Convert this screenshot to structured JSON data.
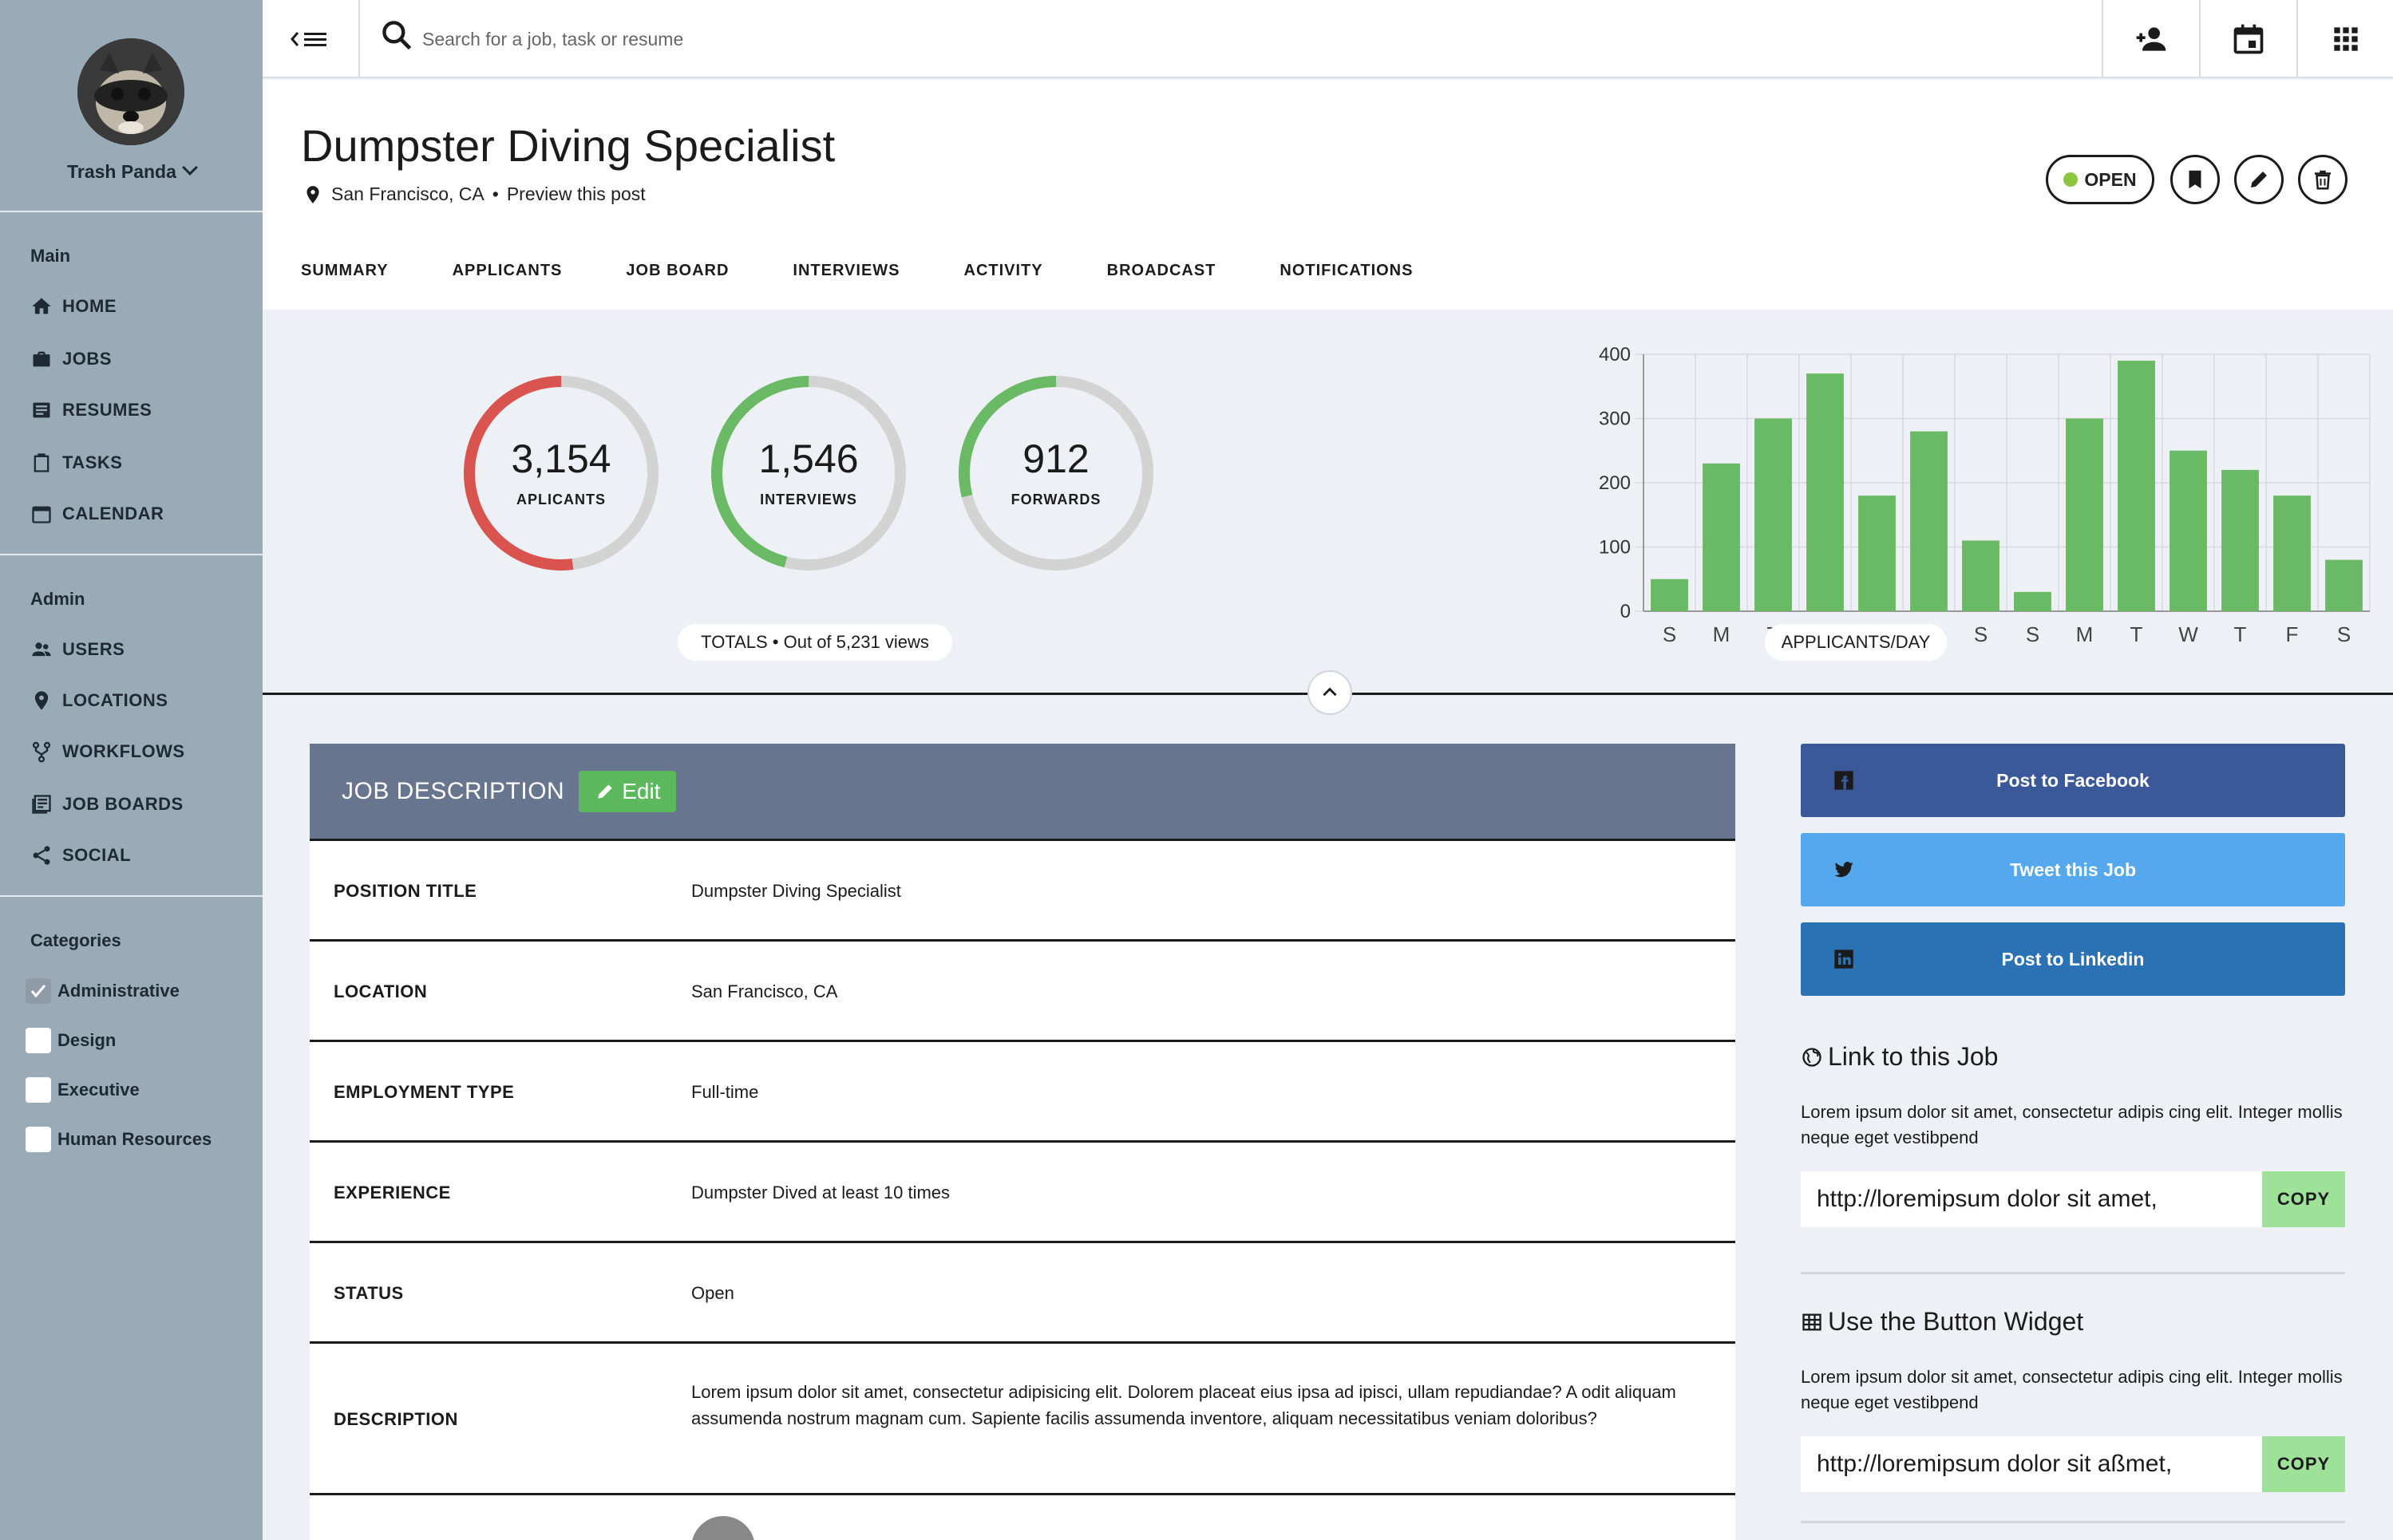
{
  "sidebar": {
    "username": "Trash Panda",
    "main_heading": "Main",
    "main_items": [
      {
        "label": "HOME",
        "icon": "home-icon"
      },
      {
        "label": "JOBS",
        "icon": "briefcase-icon"
      },
      {
        "label": "RESUMES",
        "icon": "resume-icon"
      },
      {
        "label": "TASKS",
        "icon": "clipboard-icon"
      },
      {
        "label": "CALENDAR",
        "icon": "calendar-icon"
      }
    ],
    "admin_heading": "Admin",
    "admin_items": [
      {
        "label": "USERS",
        "icon": "users-icon"
      },
      {
        "label": "LOCATIONS",
        "icon": "location-pin-icon"
      },
      {
        "label": "WORKFLOWS",
        "icon": "workflow-icon"
      },
      {
        "label": "JOB BOARDS",
        "icon": "job-boards-icon"
      },
      {
        "label": "SOCIAL",
        "icon": "share-icon"
      }
    ],
    "categories_heading": "Categories",
    "categories": [
      {
        "label": "Administrative",
        "checked": true
      },
      {
        "label": "Design",
        "checked": false
      },
      {
        "label": "Executive",
        "checked": false
      },
      {
        "label": "Human Resources",
        "checked": false
      }
    ]
  },
  "topbar": {
    "search_placeholder": "Search for a job, task or resume",
    "buttons": [
      "add-user-icon",
      "calendar-icon",
      "apps-grid-icon"
    ]
  },
  "job": {
    "title": "Dumpster Diving Specialist",
    "location": "San Francisco, CA",
    "separator": "•",
    "preview_link": "Preview this post",
    "status": "OPEN",
    "status_color": "#8cc63f",
    "tabs": [
      "SUMMARY",
      "APPLICANTS",
      "JOB BOARD",
      "INTERVIEWS",
      "ACTIVITY",
      "BROADCAST",
      "NOTIFICATIONS"
    ]
  },
  "stats": {
    "rings": [
      {
        "value": "3,154",
        "label": "APLICANTS",
        "fraction": 0.52,
        "color": "#d9534f"
      },
      {
        "value": "1,546",
        "label": "INTERVIEWS",
        "fraction": 0.46,
        "color": "#6ab964"
      },
      {
        "value": "912",
        "label": "FORWARDS",
        "fraction": 0.29,
        "color": "#6ab964"
      }
    ],
    "totals_label": "TOTALS • Out of 5,231 views",
    "chart_label": "APPLICANTS/DAY"
  },
  "chart_data": {
    "type": "bar",
    "categories": [
      "S",
      "M",
      "T",
      "W",
      "T",
      "F",
      "S",
      "S",
      "M",
      "T",
      "W",
      "T",
      "F",
      "S"
    ],
    "values": [
      50,
      230,
      300,
      370,
      180,
      280,
      110,
      30,
      300,
      390,
      250,
      220,
      180,
      80
    ],
    "yticks": [
      0,
      100,
      200,
      300,
      400
    ],
    "ylim": [
      0,
      400
    ],
    "color": "#6ab964",
    "grid": true,
    "title": "",
    "xlabel": "",
    "ylabel": ""
  },
  "description": {
    "header": "JOB DESCRIPTION",
    "edit_label": "Edit",
    "rows": [
      {
        "key": "POSITION TITLE",
        "value": "Dumpster Diving Specialist"
      },
      {
        "key": "LOCATION",
        "value": "San Francisco, CA"
      },
      {
        "key": "EMPLOYMENT TYPE",
        "value": "Full-time"
      },
      {
        "key": "EXPERIENCE",
        "value": "Dumpster Dived at least 10 times"
      },
      {
        "key": "STATUS",
        "value": "Open"
      },
      {
        "key": "DESCRIPTION",
        "value": "Lorem ipsum dolor sit amet, consectetur adipisicing elit. Dolorem placeat eius ipsa ad ipisci, ullam repudiandae? A odit aliquam assumenda nostrum magnam cum. Sapiente facilis assumenda inventore, aliquam necessitatibus veniam doloribus?"
      }
    ]
  },
  "share": {
    "facebook": {
      "label": "Post to Facebook",
      "color": "#3b5998"
    },
    "twitter": {
      "label": "Tweet this Job",
      "color": "#55a8ee"
    },
    "linkedin": {
      "label": "Post to Linkedin",
      "color": "#2b72b5"
    },
    "link_heading": "Link to this Job",
    "link_text": "Lorem ipsum dolor sit amet, consectetur adipis cing elit. Integer mollis neque eget vestibpend",
    "link_value": "http://loremipsum dolor sit amet,",
    "copy_label": "COPY",
    "widget_heading": "Use the Button Widget",
    "widget_text": "Lorem ipsum dolor sit amet, consectetur adipis cing elit. Integer mollis neque eget vestibpend",
    "widget_value": "http://loremipsum dolor sit aßmet,"
  }
}
